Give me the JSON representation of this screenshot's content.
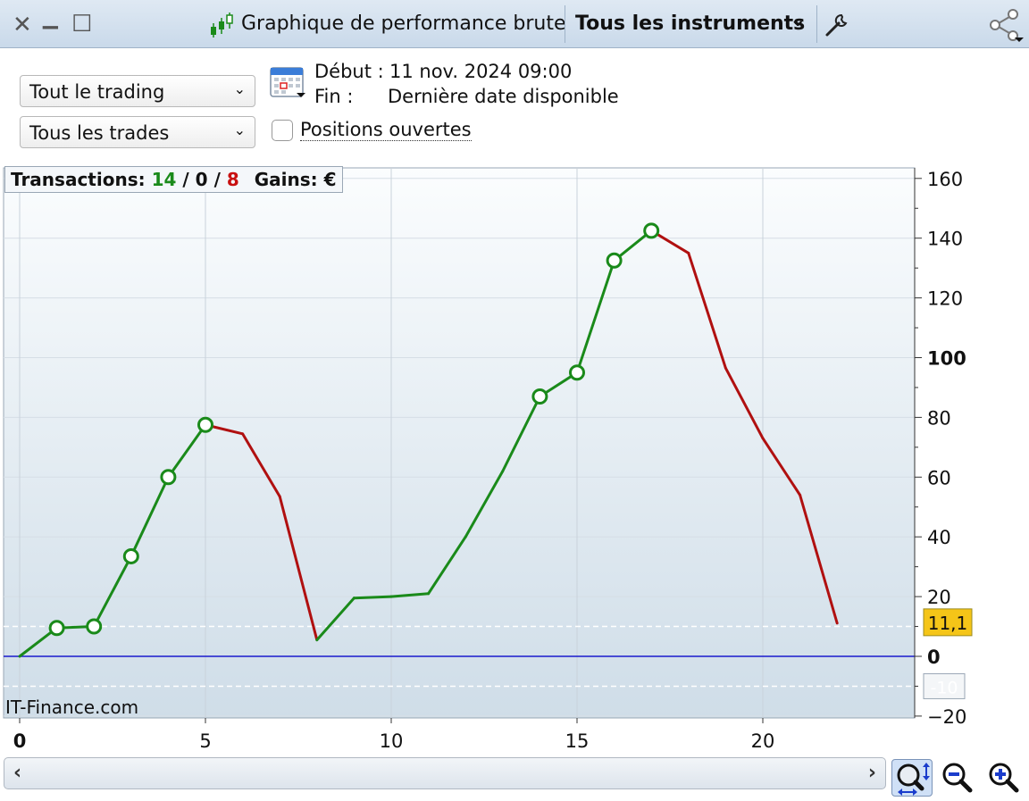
{
  "titlebar": {
    "close_glyph": "✕",
    "minimize_glyph": "▁",
    "maximize_glyph": "☐",
    "title": "Graphique de performance brute",
    "instruments_label": "Tous les instruments",
    "instruments_chevron": "⌄"
  },
  "controls": {
    "trading_select": "Tout le trading",
    "trades_select": "Tous les trades",
    "chevron": "⌄",
    "start_label": "Début :",
    "start_value": "11 nov. 2024 09:00",
    "end_label": "Fin :",
    "end_value": "Dernière date disponible",
    "open_positions_label": "Positions ouvertes",
    "open_positions_checked": false
  },
  "info": {
    "transactions_label": "Transactions:",
    "winning": "14",
    "sep1": "/",
    "neutral": "0",
    "sep2": "/",
    "losing": "8",
    "gains_label": "Gains:",
    "currency": "€"
  },
  "watermark": "IT-Finance.com",
  "colors": {
    "gain": "#1a8a1a",
    "loss": "#b01010",
    "zero_line": "#1a1acc",
    "current_badge": "#f5c518"
  },
  "chart_data": {
    "type": "line",
    "x": [
      0,
      1,
      2,
      3,
      4,
      5,
      6,
      7,
      8,
      9,
      10,
      11,
      12,
      13,
      14,
      15,
      16,
      17,
      18,
      19,
      20,
      21,
      22
    ],
    "y": [
      0,
      9.5,
      10,
      33.5,
      60,
      77.5,
      74.5,
      53.5,
      5.5,
      19.5,
      20,
      21,
      40,
      62,
      87,
      95,
      132.5,
      142.5,
      135,
      96.5,
      73,
      54,
      11.1
    ],
    "segment_colors": [
      "g",
      "g",
      "g",
      "g",
      "g",
      "r",
      "r",
      "r",
      "g",
      "g",
      "g",
      "g",
      "g",
      "g",
      "g",
      "g",
      "g",
      "r",
      "r",
      "r",
      "r",
      "r"
    ],
    "markers": [
      1,
      2,
      3,
      4,
      5,
      14,
      15,
      16,
      17
    ],
    "xlim": [
      0,
      24.3
    ],
    "ylim": [
      -22,
      162
    ],
    "x_ticks": [
      0,
      5,
      10,
      15,
      20
    ],
    "y_ticks": [
      -20,
      0,
      20,
      40,
      60,
      80,
      100,
      120,
      140,
      160
    ],
    "y_ticks_bold": [
      0,
      100
    ],
    "x_ticks_bold": [
      0
    ],
    "current_value_label": "11,1",
    "lower_band_label": "-10",
    "upper_band": 10,
    "lower_band": -10,
    "grid": true
  },
  "scroll": {
    "left_arrow": "‹",
    "right_arrow": "›"
  },
  "zoom": {
    "fit_icon": "zoom-fit-icon",
    "out_icon": "zoom-out-icon",
    "in_icon": "zoom-in-icon"
  }
}
